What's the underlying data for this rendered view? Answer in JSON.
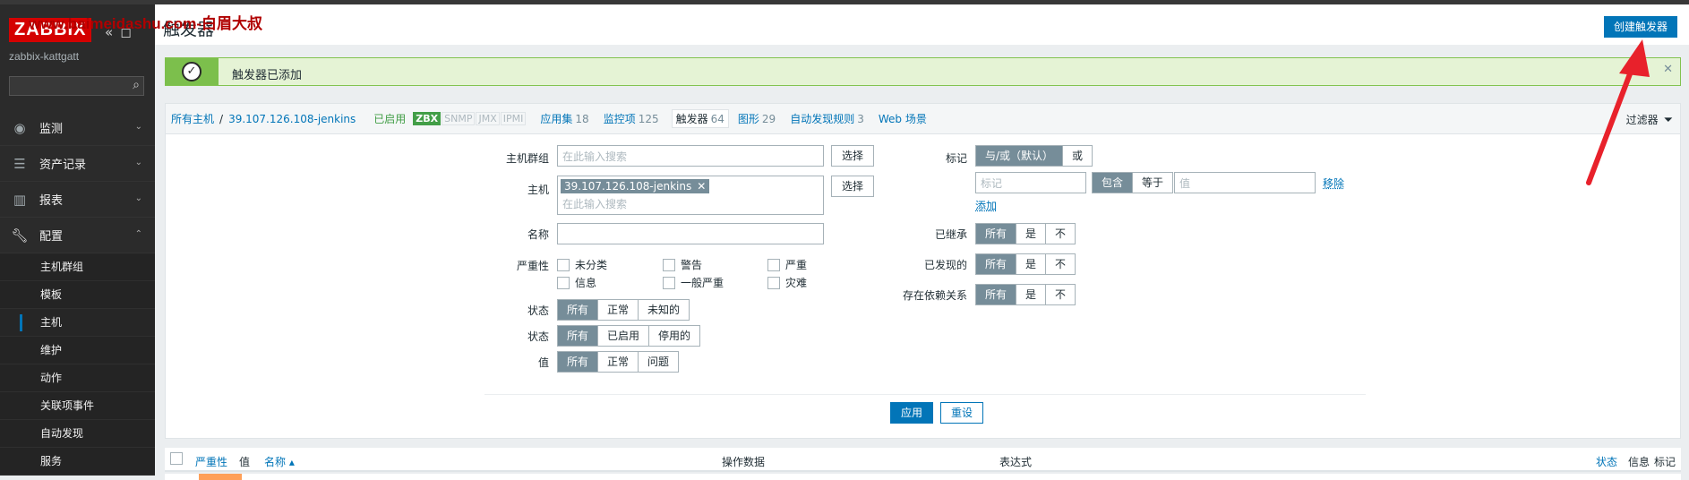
{
  "app": {
    "logo": "ZABBIX",
    "server_name": "zabbix-kattgatt",
    "watermark": "www.baimeidashu.com-白眉大叔",
    "search_placeholder": ""
  },
  "menu": {
    "items": [
      {
        "label": "监测",
        "icon": "eye-icon"
      },
      {
        "label": "资产记录",
        "icon": "list-icon"
      },
      {
        "label": "报表",
        "icon": "chart-icon"
      },
      {
        "label": "配置",
        "icon": "wrench-icon"
      }
    ],
    "submenu": [
      "主机群组",
      "模板",
      "主机",
      "维护",
      "动作",
      "关联项事件",
      "自动发现",
      "服务"
    ],
    "active_sub": "主机"
  },
  "header": {
    "title": "触发器",
    "create_button": "创建触发器"
  },
  "message": {
    "text": "触发器已添加"
  },
  "breadcrumbs": {
    "all_hosts": "所有主机",
    "separator": "/",
    "host": "39.107.126.108-jenkins",
    "status": "已启用",
    "zbx": "ZBX",
    "snmp": "SNMP",
    "jmx": "JMX",
    "ipmi": "IPMI",
    "apps_label": "应用集",
    "apps_count": "18",
    "items_label": "监控项",
    "items_count": "125",
    "triggers_label": "触发器",
    "triggers_count": "64",
    "graphs_label": "图形",
    "graphs_count": "29",
    "discovery_label": "自动发现规则",
    "discovery_count": "3",
    "web_label": "Web 场景"
  },
  "filter": {
    "tab_label": "过滤器",
    "host_group_label": "主机群组",
    "host_group_placeholder": "在此输入搜索",
    "select_button": "选择",
    "host_label": "主机",
    "host_value": "39.107.126.108-jenkins",
    "host_placeholder": "在此输入搜索",
    "name_label": "名称",
    "severity_label": "严重性",
    "severities": [
      "未分类",
      "警告",
      "严重",
      "信息",
      "一般严重",
      "灾难"
    ],
    "state_label": "状态",
    "state_options": [
      "所有",
      "正常",
      "未知的"
    ],
    "status_label": "状态",
    "status_options": [
      "所有",
      "已启用",
      "停用的"
    ],
    "value_label": "值",
    "value_options": [
      "所有",
      "正常",
      "问题"
    ],
    "tags_label": "标记",
    "tag_mode_options": [
      "与/或（默认）",
      "或"
    ],
    "tag_placeholder": "标记",
    "tag_op_options": [
      "包含",
      "等于"
    ],
    "value_placeholder": "值",
    "remove_link": "移除",
    "add_link": "添加",
    "inherited_label": "已继承",
    "discovered_label": "已发现的",
    "dependency_label": "存在依赖关系",
    "yes_no_options": [
      "所有",
      "是",
      "不"
    ],
    "apply_button": "应用",
    "reset_button": "重设"
  },
  "table": {
    "columns": {
      "severity": "严重性",
      "value": "值",
      "name": "名称 ▴",
      "operational_data": "操作数据",
      "expression": "表达式",
      "status": "状态",
      "info": "信息",
      "tags": "标记"
    }
  },
  "colors": {
    "accent": "#0275b8",
    "success": "#82c350",
    "sidebar": "#2b2b2b",
    "brand": "#d40000",
    "annotation_arrow": "#e8212b"
  }
}
